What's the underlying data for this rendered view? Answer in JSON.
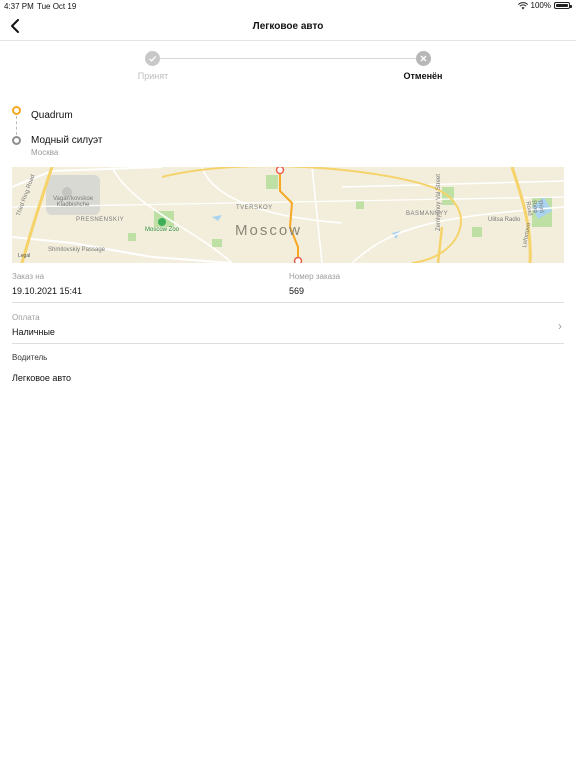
{
  "status": {
    "time": "4:37 PM",
    "date": "Tue Oct 19",
    "battery": "100%"
  },
  "nav": {
    "title": "Легковое авто"
  },
  "steps": [
    {
      "label": "Принят",
      "state": "done"
    },
    {
      "label": "Отменён",
      "state": "current"
    }
  ],
  "route": {
    "from": "Quadrum",
    "to": "Модный силуэт",
    "to_city": "Москва"
  },
  "map": {
    "city_label": "Moscow",
    "labels": [
      "Vagan'kovskoe Kladbishche",
      "PRESNENSKIY",
      "Moscow Zoo",
      "TVERSKOY",
      "BASMANNYY",
      "Ulitsa Radio",
      "Shmitovskiy Passage",
      "Third Ring Road",
      "Zemlyanoy Val Street",
      "Lefortovo"
    ],
    "legal": "Legal",
    "route_color": "#f7a823"
  },
  "order": {
    "date_label": "Заказ на",
    "date_value": "19.10.2021 15:41",
    "number_label": "Номер заказа",
    "number_value": "569",
    "payment_label": "Оплата",
    "payment_value": "Наличные",
    "driver_label": "Водитель",
    "driver_value": "Легковое авто"
  }
}
